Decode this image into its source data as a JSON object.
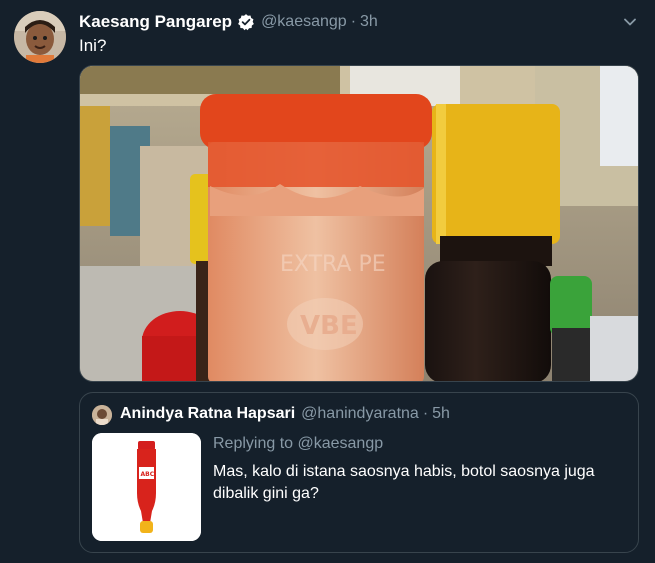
{
  "tweet": {
    "author_name": "Kaesang Pangarep",
    "handle": "@kaesangp",
    "separator": "·",
    "time": "3h",
    "text": "Ini?",
    "verified_icon": "verified-badge-icon",
    "menu_icon": "chevron-down-icon",
    "photo_label": "VBE"
  },
  "quote": {
    "author_name": "Anindya Ratna Hapsari",
    "handle": "@hanindyaratna",
    "separator": "·",
    "time": "5h",
    "replying_to": "Replying to @kaesangp",
    "text": "Mas, kalo di istana saosnya habis, botol saosnya juga dibalik gini ga?",
    "thumb_label": "ABC"
  },
  "colors": {
    "background": "#15202b",
    "secondary_text": "#8899a6",
    "border": "#38444d",
    "verified": "#ffffff"
  }
}
